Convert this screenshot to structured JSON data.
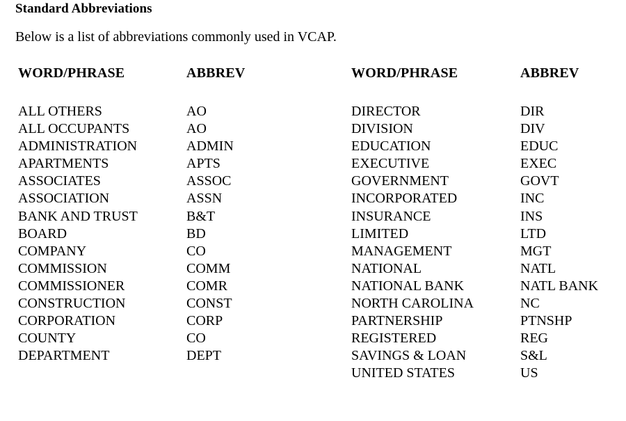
{
  "document": {
    "title": "Standard Abbreviations",
    "intro": "Below is a list of abbreviations commonly used in VCAP.",
    "background_color": "#ffffff",
    "text_color": "#000000"
  },
  "table": {
    "headers": {
      "left_word": "WORD/PHRASE",
      "left_abbrev": "ABBREV",
      "right_word": "WORD/PHRASE",
      "right_abbrev": "ABBREV"
    },
    "left_column": [
      {
        "word": "ALL OTHERS",
        "abbrev": "AO"
      },
      {
        "word": "ALL OCCUPANTS",
        "abbrev": "AO"
      },
      {
        "word": "ADMINISTRATION",
        "abbrev": "ADMIN"
      },
      {
        "word": "APARTMENTS",
        "abbrev": "APTS"
      },
      {
        "word": "ASSOCIATES",
        "abbrev": "ASSOC"
      },
      {
        "word": "ASSOCIATION",
        "abbrev": "ASSN"
      },
      {
        "word": "BANK AND TRUST",
        "abbrev": "B&T"
      },
      {
        "word": "BOARD",
        "abbrev": "BD"
      },
      {
        "word": "COMPANY",
        "abbrev": "CO"
      },
      {
        "word": "COMMISSION",
        "abbrev": "COMM"
      },
      {
        "word": "COMMISSIONER",
        "abbrev": "COMR"
      },
      {
        "word": "CONSTRUCTION",
        "abbrev": "CONST"
      },
      {
        "word": "CORPORATION",
        "abbrev": "CORP"
      },
      {
        "word": "COUNTY",
        "abbrev": "CO"
      },
      {
        "word": "DEPARTMENT",
        "abbrev": "DEPT"
      }
    ],
    "right_column": [
      {
        "word": "DIRECTOR",
        "abbrev": "DIR"
      },
      {
        "word": "DIVISION",
        "abbrev": "DIV"
      },
      {
        "word": "EDUCATION",
        "abbrev": "EDUC"
      },
      {
        "word": "EXECUTIVE",
        "abbrev": "EXEC"
      },
      {
        "word": "GOVERNMENT",
        "abbrev": "GOVT"
      },
      {
        "word": "INCORPORATED",
        "abbrev": "INC"
      },
      {
        "word": "INSURANCE",
        "abbrev": "INS"
      },
      {
        "word": "LIMITED",
        "abbrev": "LTD"
      },
      {
        "word": "MANAGEMENT",
        "abbrev": "MGT"
      },
      {
        "word": "NATIONAL",
        "abbrev": "NATL"
      },
      {
        "word": "NATIONAL BANK",
        "abbrev": "NATL BANK"
      },
      {
        "word": "NORTH CAROLINA",
        "abbrev": "NC"
      },
      {
        "word": "PARTNERSHIP",
        "abbrev": "PTNSHP"
      },
      {
        "word": "REGISTERED",
        "abbrev": "REG"
      },
      {
        "word": "SAVINGS & LOAN",
        "abbrev": "S&L"
      },
      {
        "word": "UNITED STATES",
        "abbrev": "US"
      }
    ]
  }
}
